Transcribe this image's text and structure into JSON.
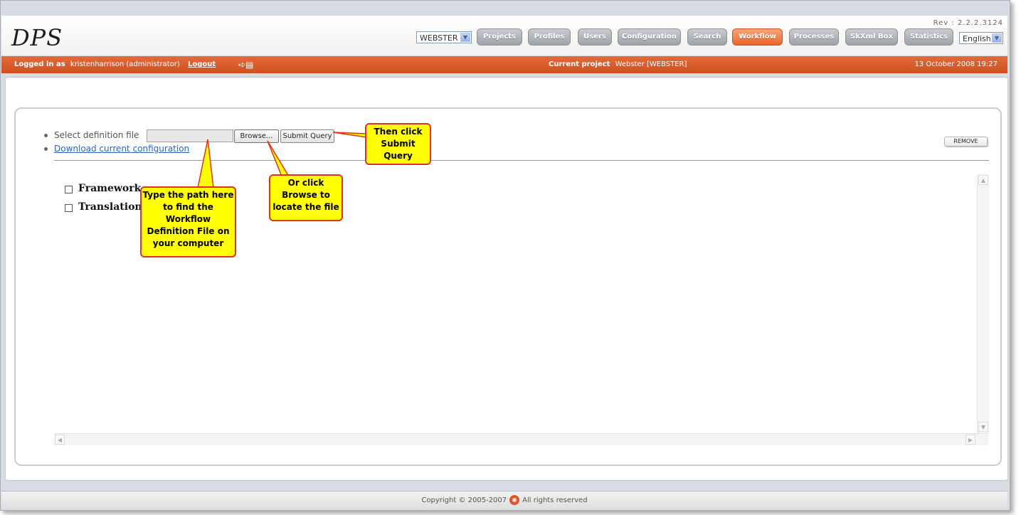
{
  "header": {
    "logo": "DPS",
    "revision": "Rev : 2.2.2.3124",
    "project_select": "WEBSTER",
    "language_select": "English",
    "nav": [
      "Projects",
      "Profiles",
      "Users",
      "Configuration",
      "Search",
      "Workflow",
      "Processes",
      "SkXml Box",
      "Statistics"
    ],
    "active_nav": "Workflow"
  },
  "statusbar": {
    "logged_in_label": "Logged in as",
    "user": "kristenharrison (administrator)",
    "logout": "Logout",
    "current_project_label": "Current project",
    "current_project": "Webster [WEBSTER]",
    "datetime": "13 October 2008 19:27"
  },
  "form": {
    "select_label": "Select definition file",
    "browse_label": "Browse...",
    "submit_label": "Submit Query",
    "download_link": "Download current configuration",
    "remove_label": "REMOVE"
  },
  "tree": {
    "items": [
      "Framework",
      "Translation"
    ]
  },
  "callouts": {
    "submit": "Then click Submit Query",
    "browse": "Or click Browse to locate the file",
    "path": "Type the path here to find the Workflow Definition File on your computer"
  },
  "footer": {
    "copyright": "Copyright © 2005-2007",
    "rights": "All rights reserved"
  }
}
